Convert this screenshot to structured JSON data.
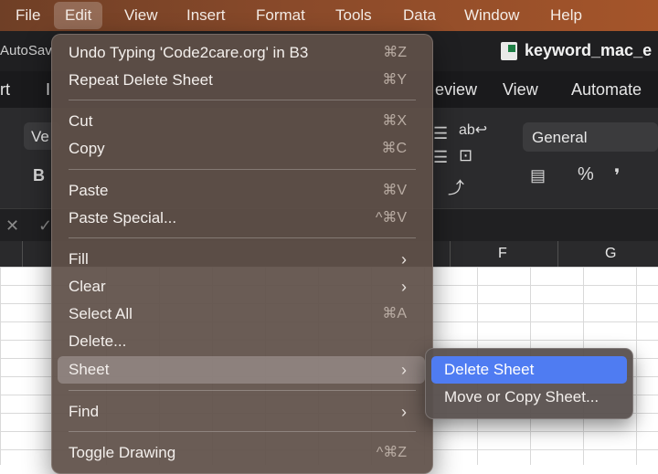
{
  "menubar": {
    "items": [
      "File",
      "Edit",
      "View",
      "Insert",
      "Format",
      "Tools",
      "Data",
      "Window",
      "Help"
    ],
    "active": "Edit"
  },
  "window": {
    "autosave_label": "AutoSav",
    "document_title": "keyword_mac_e"
  },
  "ribbon": {
    "tabs_left": [
      "rt",
      "I"
    ],
    "tabs_right": [
      "eview",
      "View",
      "Automate"
    ],
    "font_box_partial": "Ve",
    "bold_label": "B",
    "number_format": "General",
    "percent_symbol": "%",
    "comma_symbol": "❜"
  },
  "formula_bar": {
    "cancel_symbol": "✕",
    "enter_symbol": "✓"
  },
  "sheet": {
    "column_headers": [
      "F",
      "G"
    ]
  },
  "edit_menu": {
    "undo": {
      "label": "Undo Typing 'Code2care.org' in B3",
      "shortcut": "⌘Z"
    },
    "repeat": {
      "label": "Repeat Delete Sheet",
      "shortcut": "⌘Y"
    },
    "cut": {
      "label": "Cut",
      "shortcut": "⌘X"
    },
    "copy": {
      "label": "Copy",
      "shortcut": "⌘C"
    },
    "paste": {
      "label": "Paste",
      "shortcut": "⌘V"
    },
    "paste_special": {
      "label": "Paste Special...",
      "shortcut": "^⌘V"
    },
    "fill": {
      "label": "Fill"
    },
    "clear": {
      "label": "Clear"
    },
    "select_all": {
      "label": "Select All",
      "shortcut": "⌘A"
    },
    "delete": {
      "label": "Delete..."
    },
    "sheet": {
      "label": "Sheet"
    },
    "find": {
      "label": "Find"
    },
    "toggle_drawing": {
      "label": "Toggle Drawing",
      "shortcut": "^⌘Z"
    },
    "arrow": "›"
  },
  "sheet_submenu": {
    "delete_sheet": "Delete Sheet",
    "move_copy_sheet": "Move or Copy Sheet..."
  },
  "colors": {
    "highlight": "#4f7cf2",
    "menubar_accent": "#8a4a2a"
  }
}
